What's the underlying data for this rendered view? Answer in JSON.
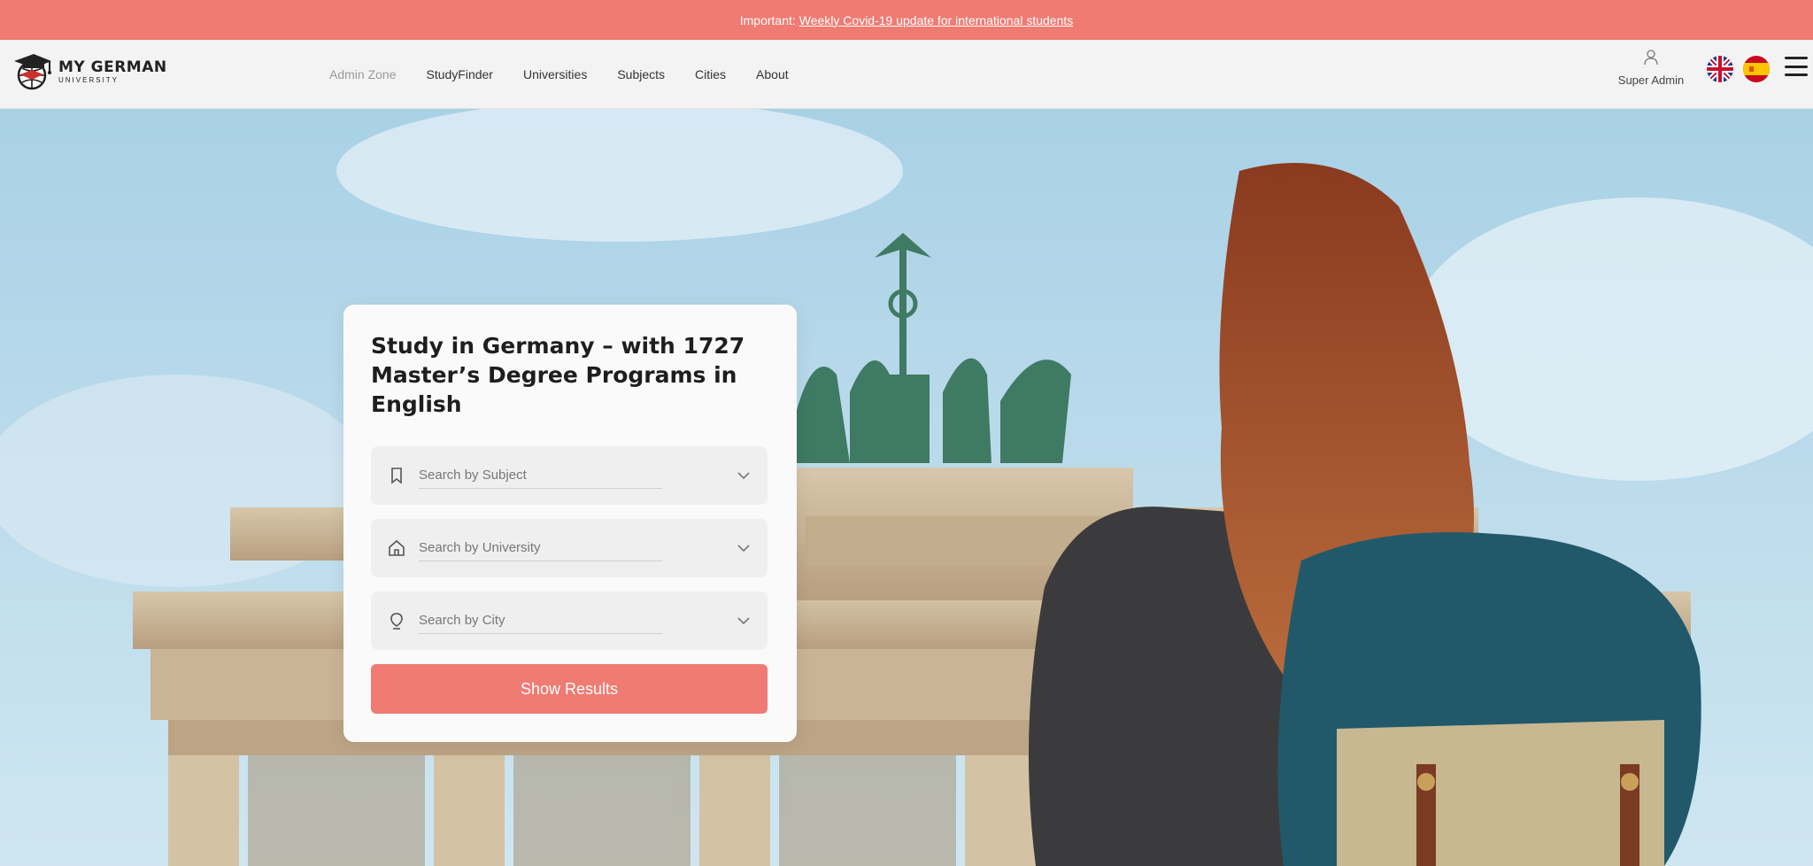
{
  "banner": {
    "prefix": "Important:",
    "link_text": "Weekly Covid-19 update for international students",
    "color": "#ef7b72"
  },
  "header": {
    "logo_line1": "MY GERMAN",
    "logo_line2": "UNIVERSITY",
    "nav": [
      {
        "label": "Admin Zone"
      },
      {
        "label": "StudyFinder"
      },
      {
        "label": "Universities"
      },
      {
        "label": "Subjects"
      },
      {
        "label": "Cities"
      },
      {
        "label": "About"
      }
    ],
    "user_label": "Super Admin",
    "user_icon": "user-icon",
    "languages": [
      "uk-flag-icon",
      "spain-flag-icon"
    ],
    "menu_icon": "hamburger-menu-icon"
  },
  "search": {
    "title": "Study in Germany – with 1727 Master’s Degree Programs in English",
    "fields": [
      {
        "icon": "bookmark-icon",
        "placeholder": "Search by Subject"
      },
      {
        "icon": "home-icon",
        "placeholder": "Search by University"
      },
      {
        "icon": "location-pin-icon",
        "placeholder": "Search by City"
      }
    ],
    "button_label": "Show Results",
    "accent": "#ef7b72"
  }
}
